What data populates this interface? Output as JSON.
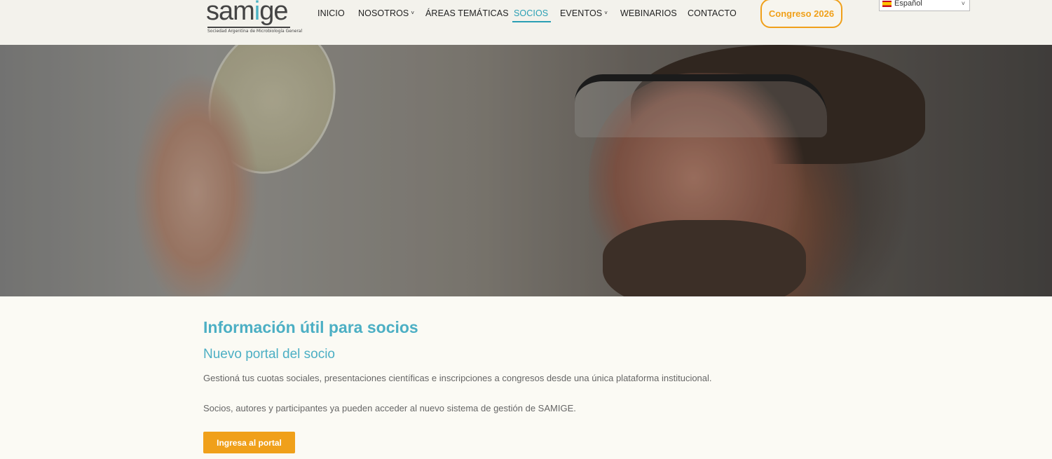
{
  "logo": {
    "word_start": "sam",
    "word_accent": "i",
    "word_end": "ge",
    "tagline": "Sociedad Argentina de Microbiología General"
  },
  "nav": {
    "items": [
      {
        "label": "INICIO",
        "has_dropdown": false,
        "active": false
      },
      {
        "label": "NOSOTROS",
        "has_dropdown": true,
        "active": false
      },
      {
        "label": "ÁREAS TEMÁTICAS",
        "has_dropdown": false,
        "active": false
      },
      {
        "label": "SOCIOS",
        "has_dropdown": false,
        "active": true
      },
      {
        "label": "EVENTOS",
        "has_dropdown": true,
        "active": false
      },
      {
        "label": "WEBINARIOS",
        "has_dropdown": false,
        "active": false
      },
      {
        "label": "CONTACTO",
        "has_dropdown": false,
        "active": false
      }
    ],
    "chevron": "˅"
  },
  "header": {
    "congreso_label": "Congreso 2026",
    "language_selected": "Español"
  },
  "content": {
    "heading": "Información útil para socios",
    "subheading": "Nuevo portal del socio",
    "paragraph_1": "Gestioná tus cuotas sociales, presentaciones científicas e inscripciones a congresos desde una única plataforma institucional.",
    "paragraph_2": "Socios, autores y participantes ya pueden acceder al nuevo sistema de gestión de SAMIGE.",
    "portal_button": "Ingresa al portal"
  },
  "colors": {
    "accent_teal": "#4cafc4",
    "accent_orange": "#f0a01a",
    "background": "#fbfaf4"
  }
}
